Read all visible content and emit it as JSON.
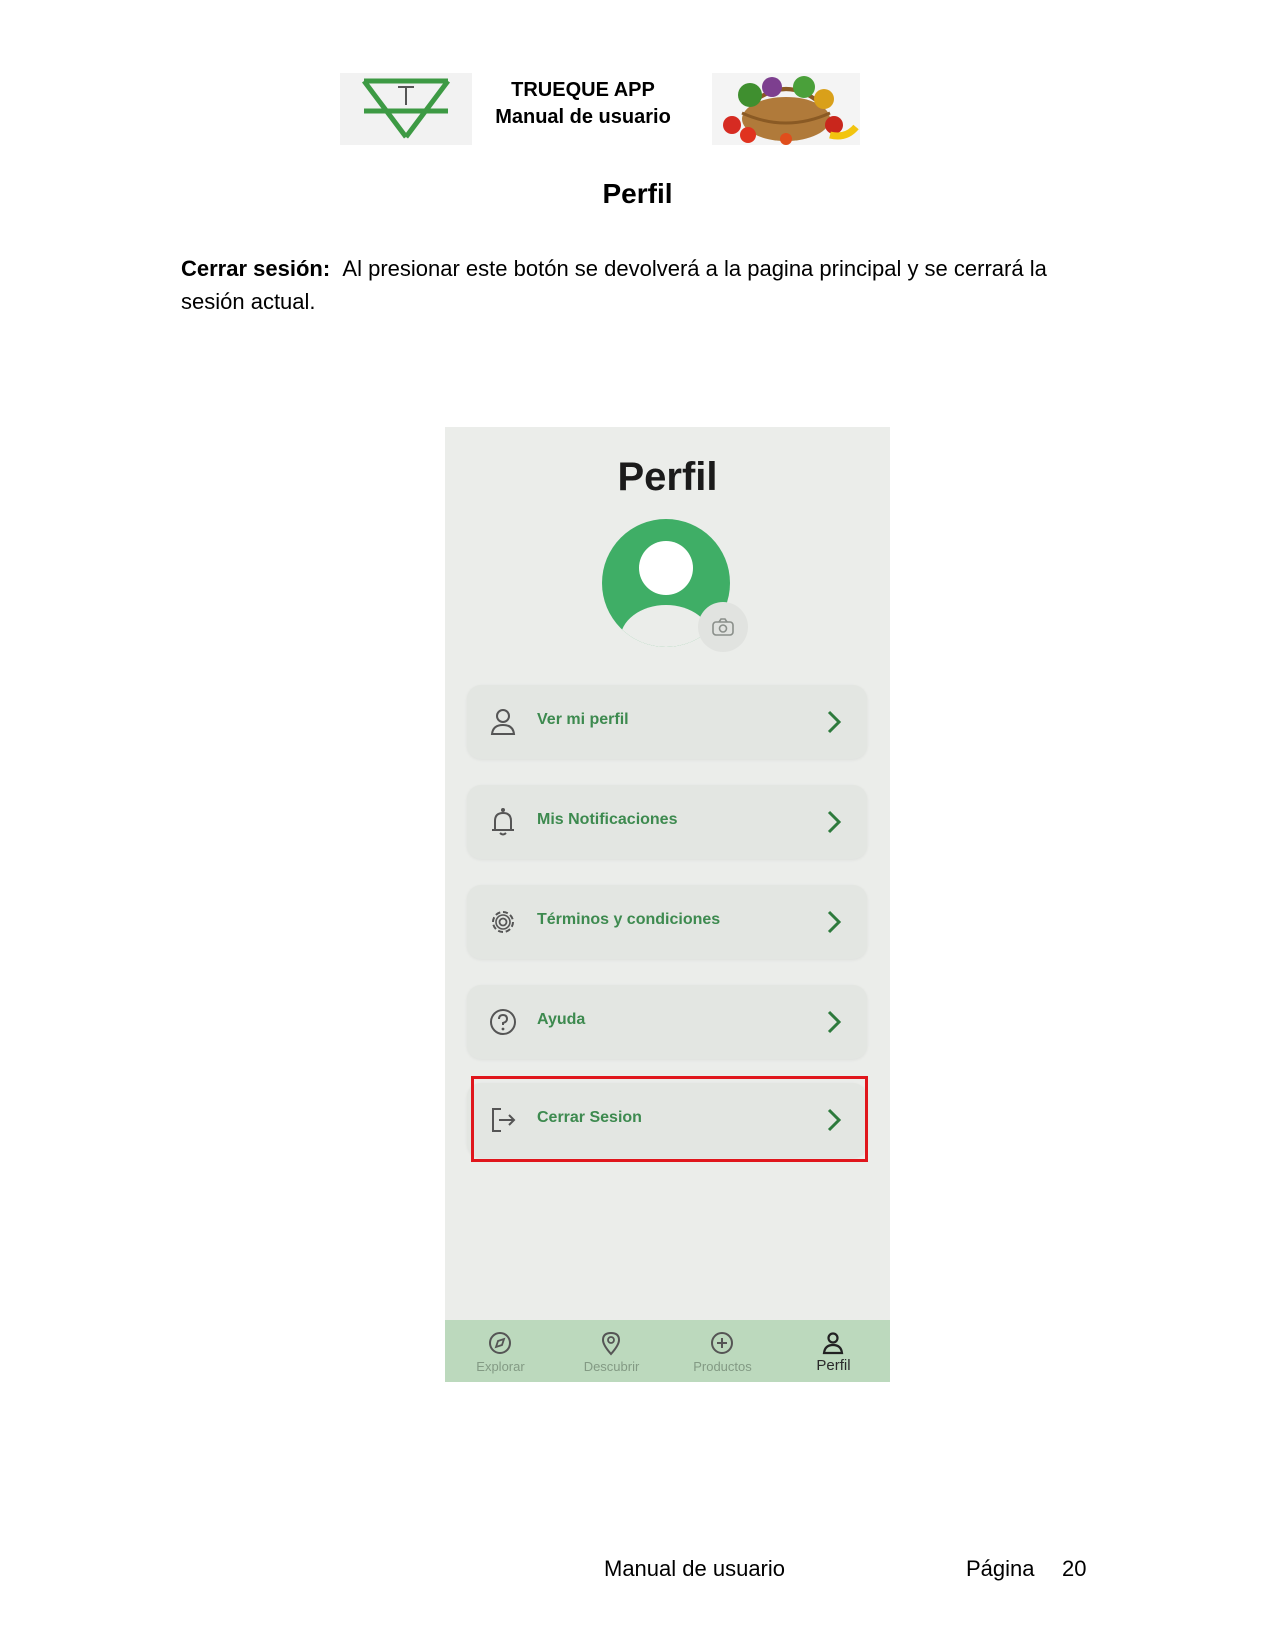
{
  "header": {
    "line1": "TRUEQUE APP",
    "line2": "Manual de usuario"
  },
  "doc": {
    "title": "Perfil",
    "label": "Cerrar sesión:",
    "text": "Al presionar este botón se devolverá a la pagina principal y se cerrará la sesión actual."
  },
  "phone": {
    "title": "Perfil",
    "menu": [
      {
        "label": "Ver mi perfil",
        "icon": "user-icon"
      },
      {
        "label": "Mis Notificaciones",
        "icon": "bell-icon"
      },
      {
        "label": "Términos y condiciones",
        "icon": "gear-icon"
      },
      {
        "label": "Ayuda",
        "icon": "help-icon"
      },
      {
        "label": "Cerrar Sesion",
        "icon": "logout-icon"
      }
    ],
    "nav": [
      {
        "label": "Explorar",
        "icon": "compass-icon"
      },
      {
        "label": "Descubrir",
        "icon": "location-pin-icon"
      },
      {
        "label": "Productos",
        "icon": "plus-circle-icon"
      },
      {
        "label": "Perfil",
        "icon": "person-icon"
      }
    ]
  },
  "footer": {
    "left": "Manual de usuario",
    "page_label": "Página",
    "page_number": "20"
  },
  "colors": {
    "accent_green": "#3fae66",
    "highlight_red": "#e0161c",
    "nav_bg": "#bcd9bd"
  }
}
